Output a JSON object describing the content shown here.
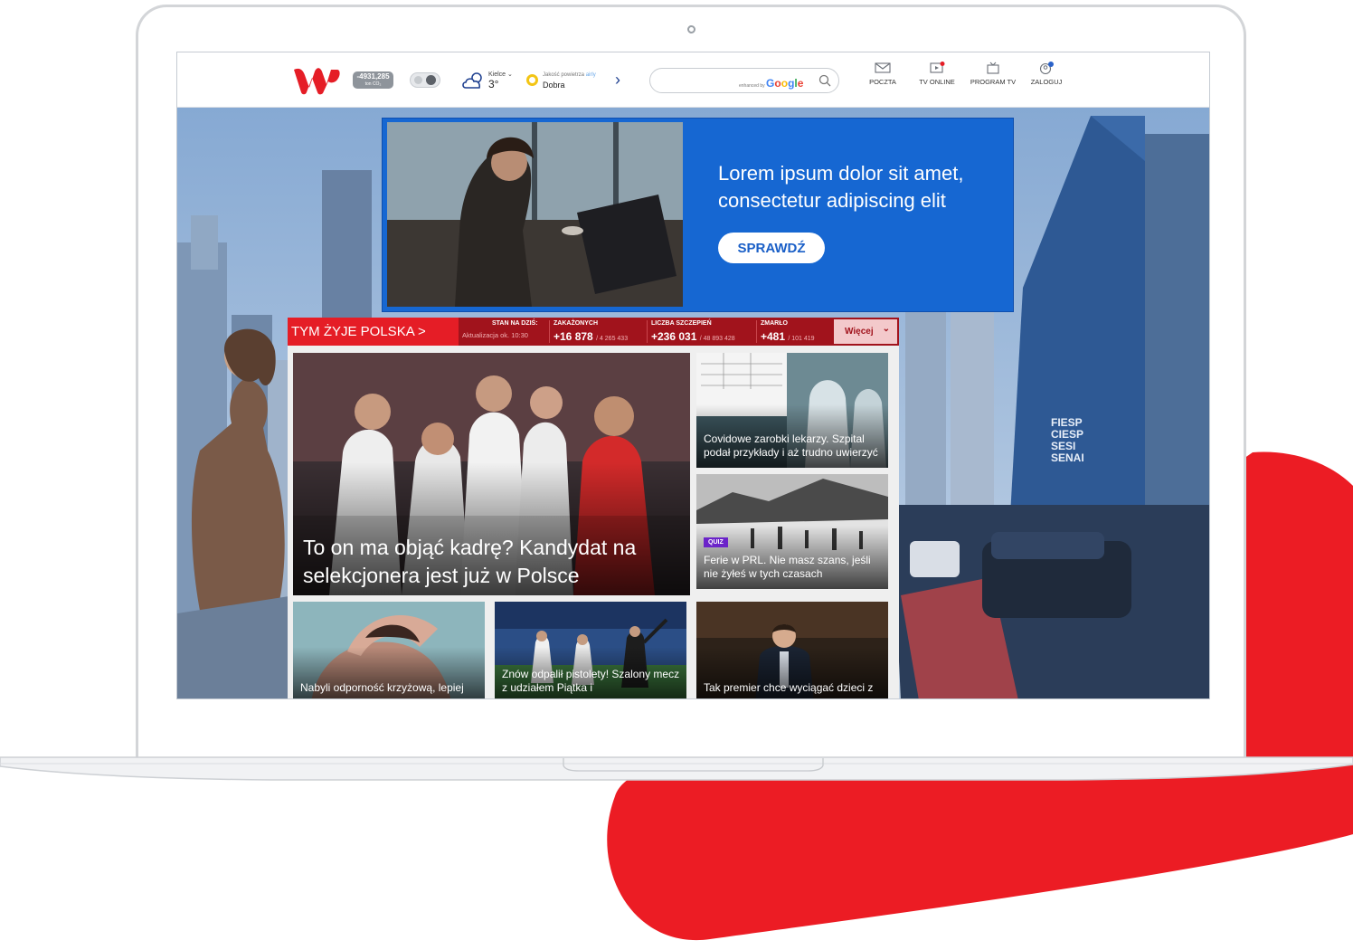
{
  "brand": {
    "red": "#e51d26",
    "blue": "#1667d2",
    "dark_red": "#a1131c"
  },
  "topbar": {
    "co2_value": "-4931,285",
    "co2_unit": "ton CO₂",
    "weather": {
      "city": "Kielce ⌄",
      "temp": "3°",
      "icon": "cloud-sun-icon"
    },
    "air_quality": {
      "label": "Jakość powietrza",
      "provider": "airly",
      "value": "Dobra"
    },
    "search": {
      "enhanced_by": "enhanced by",
      "provider": "Google",
      "placeholder": ""
    },
    "nav": [
      {
        "label": "POCZTA",
        "icon": "mail-icon"
      },
      {
        "label": "TV ONLINE",
        "icon": "tv-play-icon"
      },
      {
        "label": "PROGRAM TV",
        "icon": "tv-icon"
      },
      {
        "label": "ZALOGUJ",
        "icon": "user-icon"
      }
    ]
  },
  "ad": {
    "text": "Lorem ipsum dolor sit amet, consectetur adipiscing elit",
    "button": "SPRAWDŹ"
  },
  "ticker": {
    "title": "TYM ŻYJE POLSKA >",
    "state_label": "STAN NA DZIŚ:",
    "update": "Aktualizacja ok. 10:30",
    "stats": [
      {
        "label": "ZAKAŻONYCH",
        "value": "+16 878",
        "total": "/ 4 265 433"
      },
      {
        "label": "LICZBA SZCZEPIEŃ",
        "value": "+236 031",
        "total": "/ 48 893 428"
      },
      {
        "label": "ZMARŁO",
        "value": "+481",
        "total": "/ 101 419"
      }
    ],
    "more": "Więcej",
    "more_icon": "chevron-down-icon"
  },
  "news": {
    "main": "To on ma objąć kadrę? Kandydat na selekcjonera jest już w Polsce",
    "side1": "Covidowe zarobki lekarzy. Szpital podał przykłady i aż trudno uwierzyć",
    "side2_badge": "QUIZ",
    "side2": "Ferie w PRL. Nie masz szans, jeśli nie żyłeś w tych czasach",
    "bottom1": "Nabyli odporność krzyżową, lepiej",
    "bottom2": "Znów odpalił pistolety! Szalony mecz z udziałem Piątka i",
    "bottom3": "Tak premier chce wyciągać dzieci z"
  },
  "city_sign": [
    "FIESP",
    "CIESP",
    "SESI",
    "SENAI"
  ]
}
